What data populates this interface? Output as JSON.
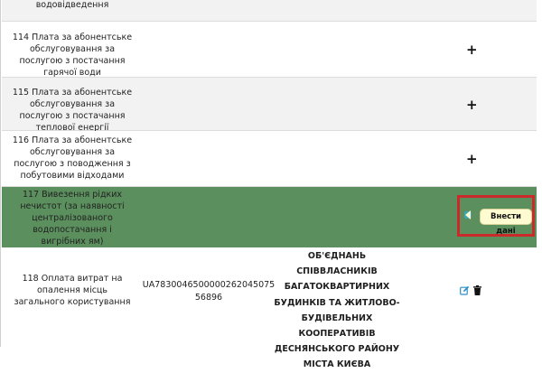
{
  "rows": [
    {
      "name": "з централізованого водовідведення",
      "action": "+"
    },
    {
      "name": "114 Плата за абонентське обслуговування за послугою з постачання гарячої води",
      "action": "+"
    },
    {
      "name": "115 Плата за абонентське обслуговування за послугою з постачання теплової енергії",
      "action": "+"
    },
    {
      "name": "116 Плата за абонентське обслуговування за послугою з поводження з побутовими відходами",
      "action": "+"
    },
    {
      "name": "117 Вивезення рідких нечистот (за наявності централізованого водопостачання і вигрібних ям)",
      "tooltip": "Внести дані"
    },
    {
      "name": "118 Оплата витрат на опалення місць загального користування",
      "iban": "UA783004650000026204507556896",
      "organization": "ОБ'ЄДНАНЬ СПІВВЛАСНИКІВ БАГАТОКВАРТИРНИХ БУДИНКІВ ТА ЖИТЛОВО-БУДІВЕЛЬНИХ КООПЕРАТИВІВ ДЕСНЯНСЬКОГО РАЙОНУ МІСТА КИЄВА"
    }
  ],
  "icons": {
    "edit": "pencil-square-icon",
    "delete": "trash-icon"
  },
  "colors": {
    "highlight_row": "#5b8f5d",
    "tooltip_bg": "#fffbd0",
    "annotation_box": "#cc2a2a",
    "edit_icon": "#2a8fc9"
  }
}
